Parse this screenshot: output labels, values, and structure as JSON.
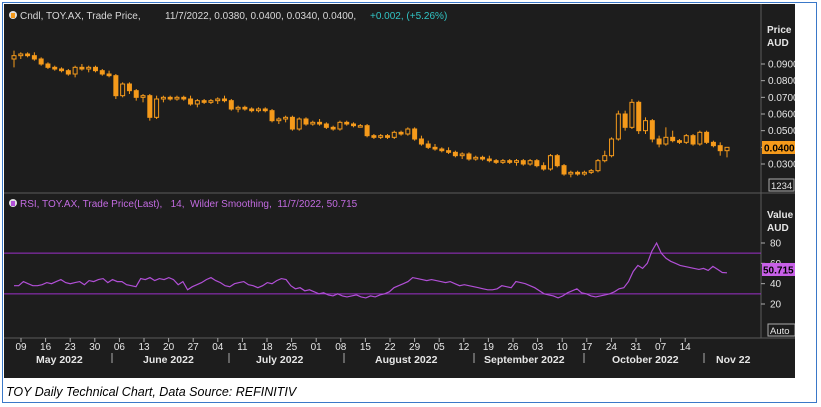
{
  "caption": "TOY Daily Technical Chart, Data Source: REFINITIV",
  "colors": {
    "background": "#1d1d1d",
    "candle": "#f59a1b",
    "rsi": "#b14fd6",
    "band": "#9b30c9",
    "legend_text": "#d8d8d8",
    "change_text": "#31c4c4"
  },
  "price_panel": {
    "legend_prefix": "Cndl, TOY.AX, Trade Price,",
    "legend_values": "11/7/2022, 0.0380, 0.0400, 0.0340, 0.0400,",
    "legend_change": "+0.002, (+5.26%)",
    "axis_title_1": "Price",
    "axis_title_2": "AUD",
    "last_price_label": "0.0400",
    "scale_box": "1234"
  },
  "rsi_panel": {
    "legend": "RSI, TOY.AX, Trade Price(Last),   14,  Wilder Smoothing,  11/7/2022, 50.715",
    "axis_title_1": "Value",
    "axis_title_2": "AUD",
    "last_value_label": "50.715",
    "auto_button": "Auto"
  },
  "chart_data": [
    {
      "type": "candlestick",
      "title": "",
      "ylabel": "Price AUD",
      "ylim": [
        0.02,
        0.1
      ],
      "yticks": [
        "0.0900",
        "0.0800",
        "0.0700",
        "0.0600",
        "0.0500",
        "0.0400",
        "0.0300"
      ],
      "ytick_values": [
        0.09,
        0.08,
        0.07,
        0.06,
        0.05,
        0.04,
        0.03
      ],
      "series": [
        {
          "name": "TOY.AX Trade Price",
          "values": [
            {
              "o": 0.093,
              "h": 0.098,
              "l": 0.088,
              "c": 0.095
            },
            {
              "o": 0.095,
              "h": 0.097,
              "l": 0.093,
              "c": 0.096
            },
            {
              "o": 0.096,
              "h": 0.097,
              "l": 0.094,
              "c": 0.095
            },
            {
              "o": 0.095,
              "h": 0.097,
              "l": 0.092,
              "c": 0.093
            },
            {
              "o": 0.093,
              "h": 0.094,
              "l": 0.089,
              "c": 0.09
            },
            {
              "o": 0.09,
              "h": 0.091,
              "l": 0.087,
              "c": 0.088
            },
            {
              "o": 0.088,
              "h": 0.089,
              "l": 0.086,
              "c": 0.087
            },
            {
              "o": 0.087,
              "h": 0.088,
              "l": 0.085,
              "c": 0.086
            },
            {
              "o": 0.086,
              "h": 0.087,
              "l": 0.083,
              "c": 0.084
            },
            {
              "o": 0.084,
              "h": 0.089,
              "l": 0.082,
              "c": 0.088
            },
            {
              "o": 0.088,
              "h": 0.09,
              "l": 0.086,
              "c": 0.087
            },
            {
              "o": 0.087,
              "h": 0.089,
              "l": 0.085,
              "c": 0.088
            },
            {
              "o": 0.088,
              "h": 0.089,
              "l": 0.085,
              "c": 0.086
            },
            {
              "o": 0.086,
              "h": 0.087,
              "l": 0.083,
              "c": 0.084
            },
            {
              "o": 0.084,
              "h": 0.086,
              "l": 0.082,
              "c": 0.083
            },
            {
              "o": 0.083,
              "h": 0.084,
              "l": 0.069,
              "c": 0.071
            },
            {
              "o": 0.071,
              "h": 0.079,
              "l": 0.07,
              "c": 0.078
            },
            {
              "o": 0.078,
              "h": 0.079,
              "l": 0.072,
              "c": 0.074
            },
            {
              "o": 0.074,
              "h": 0.075,
              "l": 0.068,
              "c": 0.07
            },
            {
              "o": 0.07,
              "h": 0.072,
              "l": 0.067,
              "c": 0.071
            },
            {
              "o": 0.071,
              "h": 0.072,
              "l": 0.056,
              "c": 0.058
            },
            {
              "o": 0.058,
              "h": 0.071,
              "l": 0.057,
              "c": 0.069
            },
            {
              "o": 0.069,
              "h": 0.071,
              "l": 0.067,
              "c": 0.07
            },
            {
              "o": 0.07,
              "h": 0.071,
              "l": 0.068,
              "c": 0.069
            },
            {
              "o": 0.069,
              "h": 0.071,
              "l": 0.068,
              "c": 0.07
            },
            {
              "o": 0.07,
              "h": 0.071,
              "l": 0.068,
              "c": 0.069
            },
            {
              "o": 0.069,
              "h": 0.071,
              "l": 0.065,
              "c": 0.066
            },
            {
              "o": 0.066,
              "h": 0.069,
              "l": 0.064,
              "c": 0.068
            },
            {
              "o": 0.068,
              "h": 0.069,
              "l": 0.066,
              "c": 0.067
            },
            {
              "o": 0.067,
              "h": 0.069,
              "l": 0.066,
              "c": 0.068
            },
            {
              "o": 0.068,
              "h": 0.07,
              "l": 0.066,
              "c": 0.069
            },
            {
              "o": 0.069,
              "h": 0.071,
              "l": 0.067,
              "c": 0.068
            },
            {
              "o": 0.068,
              "h": 0.069,
              "l": 0.062,
              "c": 0.063
            },
            {
              "o": 0.063,
              "h": 0.065,
              "l": 0.061,
              "c": 0.064
            },
            {
              "o": 0.064,
              "h": 0.065,
              "l": 0.062,
              "c": 0.063
            },
            {
              "o": 0.063,
              "h": 0.064,
              "l": 0.061,
              "c": 0.062
            },
            {
              "o": 0.062,
              "h": 0.064,
              "l": 0.061,
              "c": 0.063
            },
            {
              "o": 0.063,
              "h": 0.064,
              "l": 0.061,
              "c": 0.062
            },
            {
              "o": 0.062,
              "h": 0.063,
              "l": 0.055,
              "c": 0.056
            },
            {
              "o": 0.056,
              "h": 0.058,
              "l": 0.054,
              "c": 0.057
            },
            {
              "o": 0.057,
              "h": 0.059,
              "l": 0.055,
              "c": 0.058
            },
            {
              "o": 0.058,
              "h": 0.059,
              "l": 0.05,
              "c": 0.051
            },
            {
              "o": 0.051,
              "h": 0.058,
              "l": 0.05,
              "c": 0.057
            },
            {
              "o": 0.057,
              "h": 0.058,
              "l": 0.053,
              "c": 0.054
            },
            {
              "o": 0.054,
              "h": 0.056,
              "l": 0.053,
              "c": 0.055
            },
            {
              "o": 0.055,
              "h": 0.057,
              "l": 0.053,
              "c": 0.054
            },
            {
              "o": 0.054,
              "h": 0.055,
              "l": 0.051,
              "c": 0.052
            },
            {
              "o": 0.052,
              "h": 0.053,
              "l": 0.05,
              "c": 0.051
            },
            {
              "o": 0.051,
              "h": 0.056,
              "l": 0.05,
              "c": 0.055
            },
            {
              "o": 0.055,
              "h": 0.056,
              "l": 0.053,
              "c": 0.054
            },
            {
              "o": 0.054,
              "h": 0.055,
              "l": 0.052,
              "c": 0.053
            },
            {
              "o": 0.053,
              "h": 0.054,
              "l": 0.052,
              "c": 0.053
            },
            {
              "o": 0.053,
              "h": 0.054,
              "l": 0.046,
              "c": 0.047
            },
            {
              "o": 0.047,
              "h": 0.048,
              "l": 0.045,
              "c": 0.046
            },
            {
              "o": 0.046,
              "h": 0.048,
              "l": 0.045,
              "c": 0.047
            },
            {
              "o": 0.047,
              "h": 0.048,
              "l": 0.045,
              "c": 0.046
            },
            {
              "o": 0.046,
              "h": 0.05,
              "l": 0.045,
              "c": 0.049
            },
            {
              "o": 0.049,
              "h": 0.05,
              "l": 0.047,
              "c": 0.048
            },
            {
              "o": 0.048,
              "h": 0.052,
              "l": 0.047,
              "c": 0.051
            },
            {
              "o": 0.051,
              "h": 0.052,
              "l": 0.044,
              "c": 0.045
            },
            {
              "o": 0.045,
              "h": 0.047,
              "l": 0.041,
              "c": 0.042
            },
            {
              "o": 0.042,
              "h": 0.044,
              "l": 0.039,
              "c": 0.04
            },
            {
              "o": 0.04,
              "h": 0.042,
              "l": 0.038,
              "c": 0.039
            },
            {
              "o": 0.039,
              "h": 0.04,
              "l": 0.037,
              "c": 0.038
            },
            {
              "o": 0.038,
              "h": 0.04,
              "l": 0.036,
              "c": 0.037
            },
            {
              "o": 0.037,
              "h": 0.038,
              "l": 0.034,
              "c": 0.035
            },
            {
              "o": 0.035,
              "h": 0.037,
              "l": 0.033,
              "c": 0.036
            },
            {
              "o": 0.036,
              "h": 0.037,
              "l": 0.032,
              "c": 0.033
            },
            {
              "o": 0.033,
              "h": 0.035,
              "l": 0.032,
              "c": 0.034
            },
            {
              "o": 0.034,
              "h": 0.035,
              "l": 0.032,
              "c": 0.033
            },
            {
              "o": 0.033,
              "h": 0.035,
              "l": 0.031,
              "c": 0.032
            },
            {
              "o": 0.032,
              "h": 0.033,
              "l": 0.03,
              "c": 0.031
            },
            {
              "o": 0.031,
              "h": 0.033,
              "l": 0.03,
              "c": 0.032
            },
            {
              "o": 0.032,
              "h": 0.033,
              "l": 0.03,
              "c": 0.031
            },
            {
              "o": 0.031,
              "h": 0.033,
              "l": 0.029,
              "c": 0.032
            },
            {
              "o": 0.032,
              "h": 0.033,
              "l": 0.029,
              "c": 0.03
            },
            {
              "o": 0.03,
              "h": 0.033,
              "l": 0.029,
              "c": 0.032
            },
            {
              "o": 0.032,
              "h": 0.033,
              "l": 0.028,
              "c": 0.029
            },
            {
              "o": 0.029,
              "h": 0.031,
              "l": 0.026,
              "c": 0.027
            },
            {
              "o": 0.027,
              "h": 0.036,
              "l": 0.026,
              "c": 0.035
            },
            {
              "o": 0.035,
              "h": 0.036,
              "l": 0.028,
              "c": 0.029
            },
            {
              "o": 0.029,
              "h": 0.03,
              "l": 0.023,
              "c": 0.024
            },
            {
              "o": 0.024,
              "h": 0.026,
              "l": 0.022,
              "c": 0.025
            },
            {
              "o": 0.025,
              "h": 0.026,
              "l": 0.023,
              "c": 0.024
            },
            {
              "o": 0.024,
              "h": 0.026,
              "l": 0.023,
              "c": 0.025
            },
            {
              "o": 0.025,
              "h": 0.027,
              "l": 0.024,
              "c": 0.026
            },
            {
              "o": 0.026,
              "h": 0.033,
              "l": 0.025,
              "c": 0.032
            },
            {
              "o": 0.032,
              "h": 0.038,
              "l": 0.031,
              "c": 0.035
            },
            {
              "o": 0.035,
              "h": 0.046,
              "l": 0.034,
              "c": 0.045
            },
            {
              "o": 0.045,
              "h": 0.062,
              "l": 0.044,
              "c": 0.06
            },
            {
              "o": 0.06,
              "h": 0.062,
              "l": 0.05,
              "c": 0.052
            },
            {
              "o": 0.052,
              "h": 0.069,
              "l": 0.051,
              "c": 0.067
            },
            {
              "o": 0.067,
              "h": 0.068,
              "l": 0.048,
              "c": 0.05
            },
            {
              "o": 0.05,
              "h": 0.058,
              "l": 0.048,
              "c": 0.056
            },
            {
              "o": 0.056,
              "h": 0.057,
              "l": 0.043,
              "c": 0.045
            },
            {
              "o": 0.045,
              "h": 0.047,
              "l": 0.04,
              "c": 0.042
            },
            {
              "o": 0.042,
              "h": 0.052,
              "l": 0.041,
              "c": 0.046
            },
            {
              "o": 0.046,
              "h": 0.05,
              "l": 0.043,
              "c": 0.044
            },
            {
              "o": 0.044,
              "h": 0.045,
              "l": 0.042,
              "c": 0.043
            },
            {
              "o": 0.043,
              "h": 0.048,
              "l": 0.042,
              "c": 0.047
            },
            {
              "o": 0.047,
              "h": 0.048,
              "l": 0.041,
              "c": 0.042
            },
            {
              "o": 0.042,
              "h": 0.05,
              "l": 0.041,
              "c": 0.049
            },
            {
              "o": 0.049,
              "h": 0.05,
              "l": 0.042,
              "c": 0.043
            },
            {
              "o": 0.043,
              "h": 0.044,
              "l": 0.04,
              "c": 0.041
            },
            {
              "o": 0.041,
              "h": 0.043,
              "l": 0.035,
              "c": 0.038
            },
            {
              "o": 0.038,
              "h": 0.04,
              "l": 0.034,
              "c": 0.04
            }
          ]
        }
      ]
    },
    {
      "type": "line",
      "title": "",
      "ylabel": "Value AUD",
      "ylim": [
        10,
        90
      ],
      "yticks": [
        80,
        60,
        40,
        20
      ],
      "bands": [
        70,
        30
      ],
      "series": [
        {
          "name": "RSI(14)",
          "values": [
            38,
            38,
            42,
            40,
            38,
            38,
            39,
            41,
            40,
            42,
            44,
            41,
            40,
            41,
            42,
            39,
            43,
            42,
            44,
            45,
            41,
            44,
            42,
            42,
            39,
            38,
            37,
            45,
            44,
            46,
            43,
            45,
            44,
            46,
            44,
            39,
            42,
            34,
            37,
            39,
            41,
            44,
            46,
            43,
            41,
            38,
            37,
            40,
            41,
            42,
            39,
            38,
            36,
            38,
            41,
            40,
            43,
            45,
            44,
            38,
            35,
            36,
            33,
            34,
            32,
            30,
            31,
            29,
            28,
            30,
            28,
            27,
            28,
            29,
            27,
            26,
            28,
            27,
            29,
            30,
            32,
            36,
            38,
            40,
            42,
            46,
            45,
            44,
            43,
            44,
            43,
            42,
            41,
            42,
            40,
            38,
            39,
            38,
            37,
            36,
            35,
            34,
            34,
            35,
            38,
            37,
            36,
            42,
            41,
            40,
            38,
            36,
            33,
            30,
            29,
            28,
            26,
            28,
            31,
            33,
            35,
            31,
            30,
            28,
            27,
            28,
            29,
            30,
            32,
            35,
            36,
            42,
            52,
            58,
            55,
            60,
            72,
            80,
            70,
            65,
            62,
            60,
            58,
            57,
            56,
            55,
            54,
            55,
            53,
            57,
            54,
            51,
            50.7
          ]
        }
      ]
    },
    {
      "type": "axis",
      "xlabel": "",
      "ticks": [
        "09",
        "16",
        "23",
        "30",
        "06",
        "13",
        "20",
        "27",
        "04",
        "11",
        "18",
        "25",
        "01",
        "08",
        "15",
        "22",
        "29",
        "05",
        "12",
        "19",
        "26",
        "03",
        "10",
        "17",
        "24",
        "31",
        "07",
        "14"
      ],
      "months": [
        "May 2022",
        "June 2022",
        "July 2022",
        "August 2022",
        "September 2022",
        "October 2022",
        "Nov 22"
      ]
    }
  ]
}
